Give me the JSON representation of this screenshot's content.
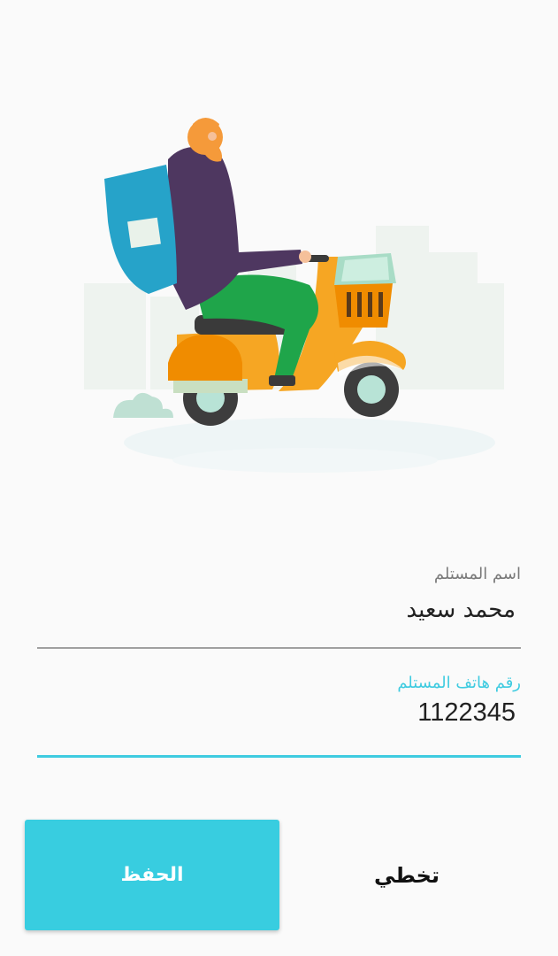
{
  "illustration": {
    "icon": "delivery-scooter-illustration"
  },
  "form": {
    "recipient_name": {
      "label": "اسم المستلم",
      "value": "محمد سعيد"
    },
    "recipient_phone": {
      "label": "رقم هاتف المستلم",
      "value": "1122345"
    }
  },
  "actions": {
    "save_label": "الحفظ",
    "skip_label": "تخطي"
  },
  "colors": {
    "accent": "#38cde0",
    "focused_underline": "#3ecbe0",
    "background": "#fafafa"
  }
}
